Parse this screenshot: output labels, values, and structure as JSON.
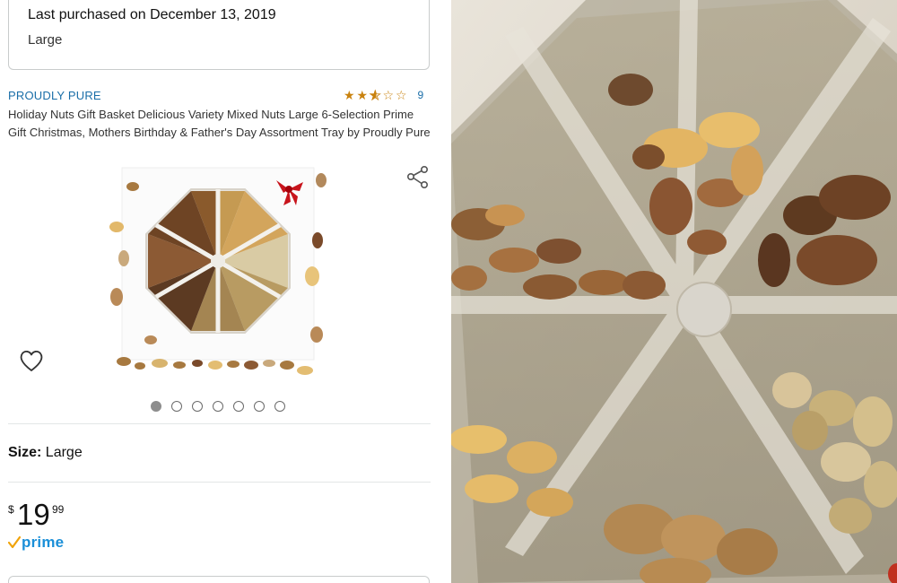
{
  "purchase": {
    "last_purchased": "Last purchased on December 13, 2019",
    "variant": "Large"
  },
  "product": {
    "brand": "PROUDLY PURE",
    "rating_stars": 2.5,
    "rating_count": "9",
    "title": "Holiday Nuts Gift Basket Delicious Variety Mixed Nuts Large 6-Selection Prime Gift Christmas, Mothers Birthday & Father's Day Assortment Tray by Proudly Pure",
    "image_count": 7,
    "active_image": 1
  },
  "size": {
    "label": "Size:",
    "value": "Large"
  },
  "price": {
    "currency": "$",
    "whole": "19",
    "fraction": "99"
  },
  "prime": {
    "label": "prime"
  },
  "icons": {
    "wishlist": "heart-icon",
    "share": "share-icon",
    "prime_check": "check-icon"
  },
  "colors": {
    "link": "#1a6ea8",
    "star": "#c9820e",
    "prime": "#1a8fd8"
  }
}
